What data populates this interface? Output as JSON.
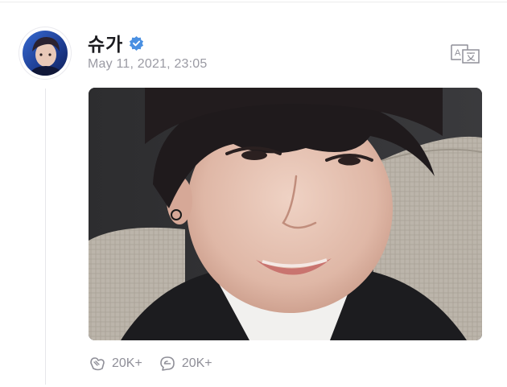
{
  "post": {
    "author_name": "슈가",
    "timestamp": "May 11, 2021, 23:05",
    "likes_count": "20K+",
    "comments_count": "20K+"
  },
  "icons": {
    "verified": "verified-badge-icon",
    "translate": "translate-icon",
    "like": "like-icon",
    "comment": "comment-icon"
  },
  "colors": {
    "verified_blue": "#4a90e2",
    "meta_gray": "#9a9aa3"
  }
}
